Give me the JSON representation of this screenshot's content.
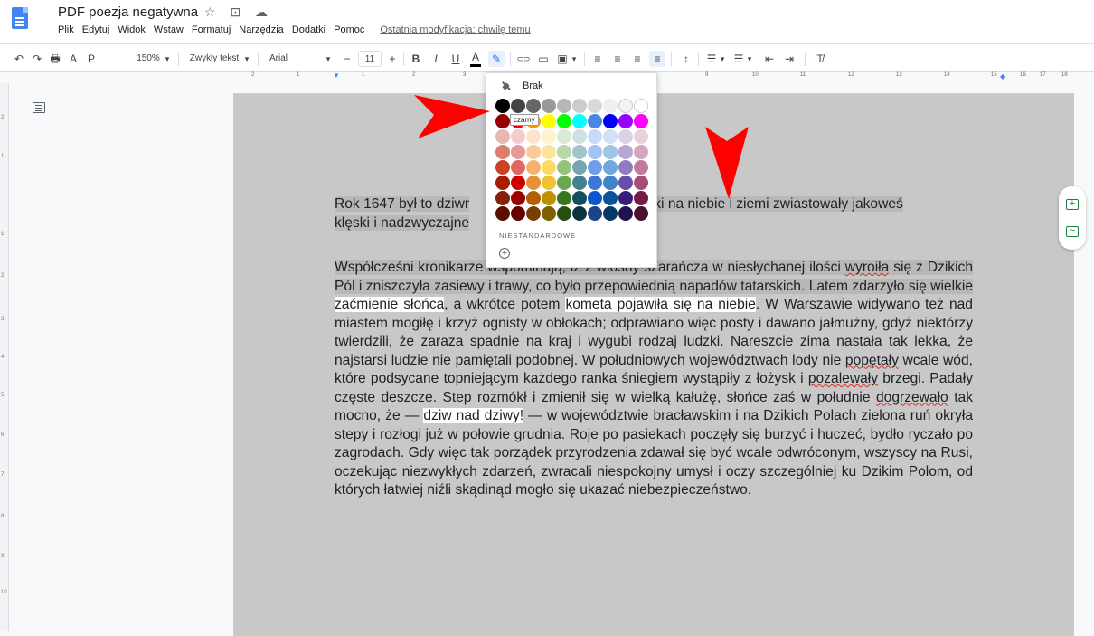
{
  "doc": {
    "title": "PDF poezja negatywna",
    "title_icons": "☆ ⊡ ☁"
  },
  "menu": {
    "items": [
      "Plik",
      "Edytuj",
      "Widok",
      "Wstaw",
      "Formatuj",
      "Narzędzia",
      "Dodatki",
      "Pomoc"
    ],
    "last_modified": "Ostatnia modyfikacja: chwilę temu"
  },
  "toolbar": {
    "undo": "↶",
    "redo": "↷",
    "print": "🖶",
    "spell": "A",
    "paint": "P",
    "zoom": "150%",
    "style": "Zwykły tekst",
    "font": "Arial",
    "font_size": "11",
    "minus": "−",
    "plus": "+",
    "bold": "B",
    "italic": "I",
    "underline": "U",
    "text_color": "A",
    "highlight": "✎",
    "link": "⊂⊃",
    "comment": "▭",
    "image": "▣",
    "align_left": "≡",
    "align_center": "≡",
    "align_right": "≡",
    "align_justify": "≡",
    "line_spacing": "↕",
    "checklist": "☰",
    "bullets": "☰",
    "indent_less": "⇤",
    "indent_more": "⇥",
    "clear": "T̸",
    "dropdown": "▾"
  },
  "ruler": {
    "top_numbers": [
      "2",
      "1",
      "1",
      "2",
      "3",
      "9",
      "10",
      "11",
      "12",
      "13",
      "14",
      "15",
      "16",
      "17",
      "18"
    ],
    "left_numbers": [
      "2",
      "1",
      "1",
      "2",
      "3",
      "4",
      "5",
      "6",
      "7",
      "8",
      "9",
      "10"
    ]
  },
  "palette": {
    "none_label": "Brak",
    "tooltip": "czarny",
    "custom_label": "NIESTANDARDOWE",
    "add_label": "+",
    "rows": [
      [
        "#000000",
        "#434343",
        "#666666",
        "#999999",
        "#b7b7b7",
        "#cccccc",
        "#d9d9d9",
        "#efefef",
        "#f3f3f3",
        "#ffffff"
      ],
      [
        "#980000",
        "#ff0000",
        "#ff9900",
        "#ffff00",
        "#00ff00",
        "#00ffff",
        "#4a86e8",
        "#0000ff",
        "#9900ff",
        "#ff00ff"
      ],
      [
        "#e6b8af",
        "#f4cccc",
        "#fce5cd",
        "#fff2cc",
        "#d9ead3",
        "#d0e0e3",
        "#c9daf8",
        "#cfe2f3",
        "#d9d2e9",
        "#ead1dc"
      ],
      [
        "#dd7e6b",
        "#ea9999",
        "#f9cb9c",
        "#ffe599",
        "#b6d7a8",
        "#a2c4c9",
        "#a4c2f4",
        "#9fc5e8",
        "#b4a7d6",
        "#d5a6bd"
      ],
      [
        "#cc4125",
        "#e06666",
        "#f6b26b",
        "#ffd966",
        "#93c47d",
        "#76a5af",
        "#6d9eeb",
        "#6fa8dc",
        "#8e7cc3",
        "#c27ba0"
      ],
      [
        "#a61c00",
        "#cc0000",
        "#e69138",
        "#f1c232",
        "#6aa84f",
        "#45818e",
        "#3c78d8",
        "#3d85c6",
        "#674ea7",
        "#a64d79"
      ],
      [
        "#85200c",
        "#990000",
        "#b45f06",
        "#bf9000",
        "#38761d",
        "#134f5c",
        "#1155cc",
        "#0b5394",
        "#351c75",
        "#741b47"
      ],
      [
        "#5b0f00",
        "#660000",
        "#783f04",
        "#7f6000",
        "#274e13",
        "#0c343d",
        "#1c4587",
        "#073763",
        "#20124d",
        "#4c1130"
      ]
    ]
  },
  "text": {
    "p1_a": "Rok 1647 był to dziwr",
    "p1_b": "e znaki na ",
    "p1_c": "niebie i ziemi zwiastowały jakoweś",
    "p1_d": "klęski i nadzwyczajne",
    "p2_a": "Współcześni kronikarze wspominają, iż z wiosny szarańcza w niesłychanej ilości ",
    "p2_w1": "wyroiła",
    "p2_b": " się z Dzikich Pól i zniszczyła zasiewy i trawy, co było przepowiednią napadów tatarskich. Latem zdarzyło się wielkie ",
    "p2_c": "zaćmienie słońca",
    "p2_d": ", a wkrótce potem ",
    "p2_e": "kometa pojawiła się na niebie",
    "p2_f": ". W Warszawie widywano też nad miastem mogiłę i krzyż ognisty w obłokach; odprawiano więc posty i dawano jałmużny, gdyż niektórzy twierdzili, że zaraza spadnie na kraj i wygubi rodzaj ludzki. Nareszcie zima nastała tak lekka, że najstarsi ludzie nie pamiętali podobnej. W południowych województwach lody nie ",
    "p2_w2": "popętały",
    "p2_g": " wcale wód, które podsycane topniejącym każdego ranka śniegiem wystąpiły z łożysk i ",
    "p2_w3": "pozalewały",
    "p2_h": " brzegi. Padały częste deszcze. Step rozmókł i zmienił się w wielką kałużę, słońce zaś w południe ",
    "p2_w4": "dogrzewało",
    "p2_i": " tak mocno, że — ",
    "p2_j": "dziw nad dziwy!",
    "p2_k": " — w województwie bracławskim i na Dzikich Polach zielona ruń okryła stepy i rozłogi już w połowie grudnia. Roje po pasiekach poczęły się burzyć i huczeć, bydło ryczało po zagrodach. Gdy więc tak porządek przyrodzenia zdawał się być wcale odwróconym, wszyscy na Rusi, oczekując niezwykłych zdarzeń, zwracali niespokojny umysł i oczy szczególniej ku Dzikim Polom, od których łatwiej niźli skądinąd mogło się ukazać niebezpieczeństwo."
  },
  "colors": {
    "arrow": "#ff0000",
    "selection": "#b8b8b8",
    "page_background": "#c8c8c8",
    "toolbar_active": "#e8f0fe",
    "brand_blue": "#4285f4"
  }
}
